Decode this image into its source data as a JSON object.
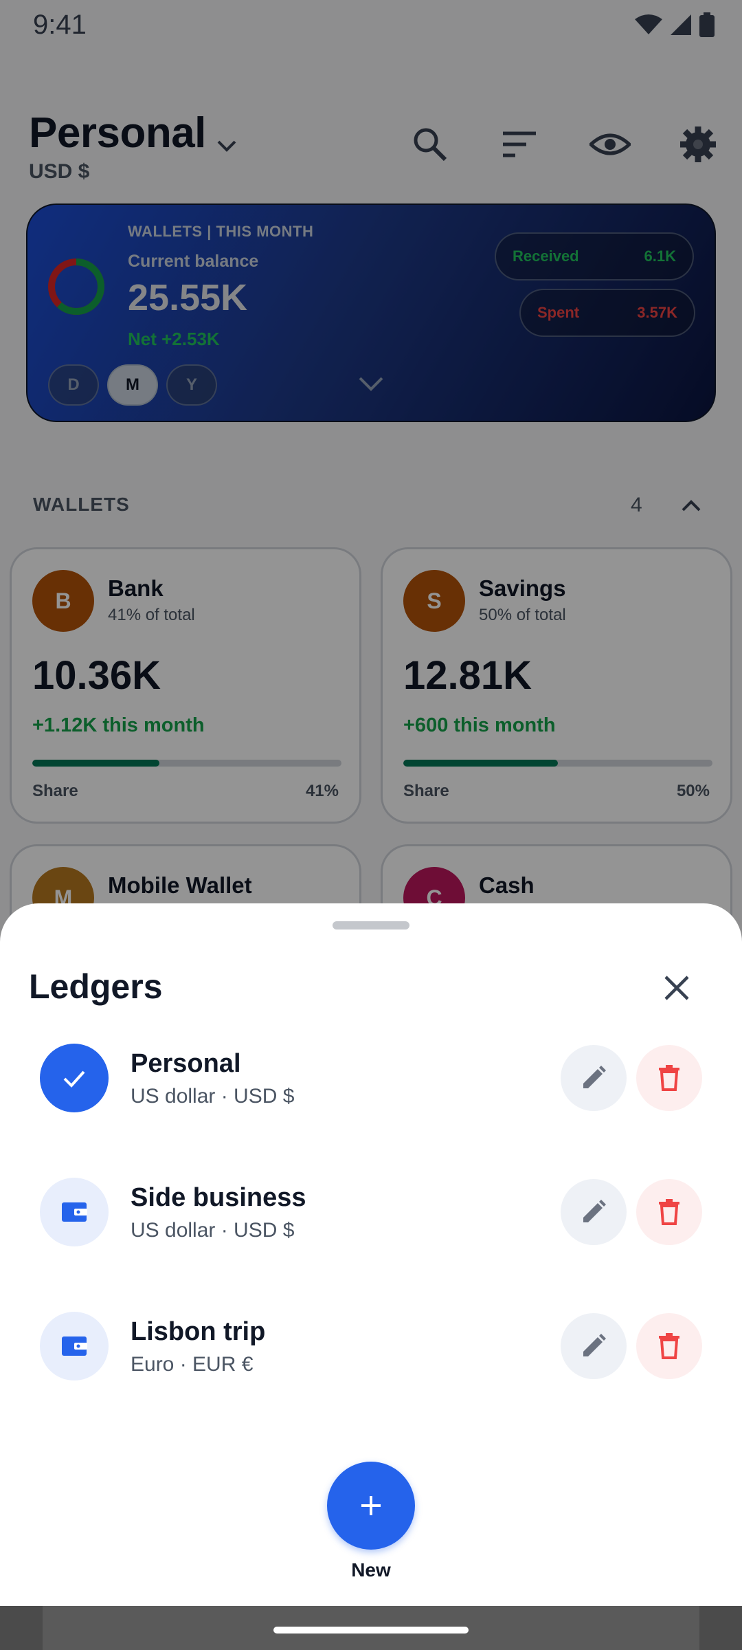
{
  "status_bar": {
    "time": "9:41"
  },
  "header": {
    "ledger_name": "Personal",
    "currency": "USD $"
  },
  "summary": {
    "label": "WALLETS | THIS MONTH",
    "sub_label": "Current balance",
    "balance": "25.55K",
    "net": "Net +2.53K",
    "received_label": "Received",
    "received_value": "6.1K",
    "spent_label": "Spent",
    "spent_value": "3.57K",
    "periods": [
      "D",
      "M",
      "Y"
    ],
    "active_period": "M"
  },
  "wallets_section": {
    "title": "WALLETS",
    "count": "4"
  },
  "wallets": [
    {
      "initial": "B",
      "name": "Bank",
      "pct_label": "41% of total",
      "amount": "10.36K",
      "delta": "+1.12K this month",
      "share_label": "Share",
      "share_pct": "41%",
      "share": 0.41,
      "color": "#b45309"
    },
    {
      "initial": "S",
      "name": "Savings",
      "pct_label": "50% of total",
      "amount": "12.81K",
      "delta": "+600 this month",
      "share_label": "Share",
      "share_pct": "50%",
      "share": 0.5,
      "color": "#b45309"
    },
    {
      "initial": "M",
      "name": "Mobile Wallet",
      "color": "#b7791f"
    },
    {
      "initial": "C",
      "name": "Cash",
      "color": "#be185d"
    }
  ],
  "sheet": {
    "title": "Ledgers",
    "ledgers": [
      {
        "name": "Personal",
        "subtitle": "US dollar · USD $",
        "selected": true
      },
      {
        "name": "Side business",
        "subtitle": "US dollar · USD $",
        "selected": false
      },
      {
        "name": "Lisbon trip",
        "subtitle": "Euro · EUR €",
        "selected": false
      }
    ],
    "new_label": "New"
  },
  "colors": {
    "accent": "#2563eb",
    "positive": "#16a34a",
    "negative": "#ef4444"
  }
}
